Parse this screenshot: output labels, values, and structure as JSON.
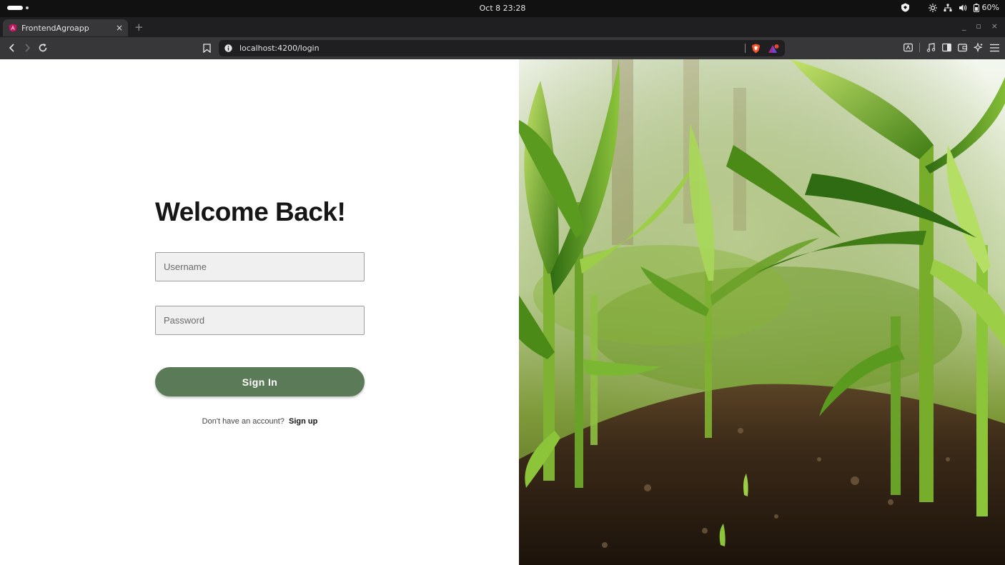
{
  "os": {
    "clock": "Oct 8  23:28",
    "battery": "60%"
  },
  "browser": {
    "tab_title": "FrontendAgroapp",
    "tab_close": "×",
    "new_tab": "+",
    "url": "localhost:4200/login",
    "window_controls": [
      "_",
      "▫",
      "×"
    ]
  },
  "login": {
    "heading": "Welcome Back!",
    "username_placeholder": "Username",
    "password_placeholder": "Password",
    "signin_label": "Sign In",
    "no_account_text": "Don't have an account?",
    "signup_label": "Sign up"
  },
  "colors": {
    "signin_button": "#5b7b58",
    "heading": "#161616"
  },
  "icons": [
    "back-icon",
    "forward-icon",
    "reload-icon",
    "bookmark-icon",
    "site-info-icon",
    "brave-shield-icon",
    "brave-rewards-icon",
    "reader-mode-icon",
    "media-icon",
    "sidebar-icon",
    "wallet-icon",
    "leo-ai-icon",
    "menu-icon"
  ]
}
